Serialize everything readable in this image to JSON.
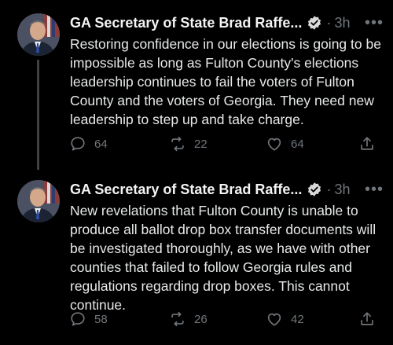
{
  "tweets": [
    {
      "author": "GA Secretary of State Brad Raffe...",
      "separator": "·",
      "time": "3h",
      "more": "•••",
      "text": "Restoring confidence in our elections is going to be impossible as long as Fulton County's elections leadership continues to fail the voters of Fulton County and the voters of Georgia. They need new leadership to step up and take charge.",
      "replies": "64",
      "retweets": "22",
      "likes": "64"
    },
    {
      "author": "GA Secretary of State Brad Raffe...",
      "separator": "·",
      "time": "3h",
      "more": "•••",
      "text": "New revelations that Fulton County is unable to produce all ballot drop box transfer documents will be investigated thoroughly, as we have with other counties that failed to follow Georgia rules and regulations regarding drop boxes. This cannot continue.",
      "replies": "58",
      "retweets": "26",
      "likes": "42"
    }
  ],
  "colors": {
    "background": "#000000",
    "text": "#e7e9ea",
    "muted": "#71767b",
    "thread_line": "#3e4145"
  },
  "icons": [
    "verified-badge-icon",
    "reply-icon",
    "retweet-icon",
    "like-icon",
    "share-icon",
    "more-icon"
  ]
}
